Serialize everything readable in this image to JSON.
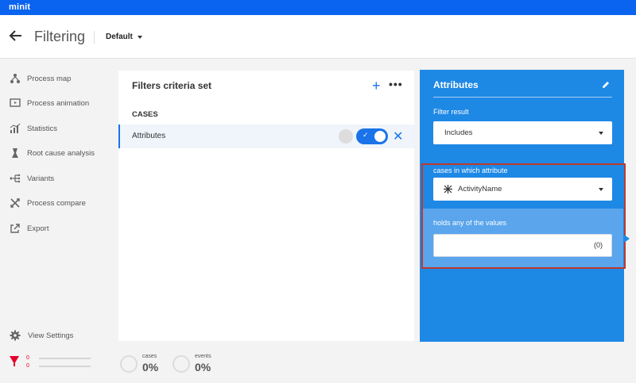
{
  "app": {
    "brand": "minit"
  },
  "header": {
    "title": "Filtering",
    "preset": "Default"
  },
  "sidebar": {
    "items": [
      {
        "label": "Process map",
        "icon": "process-map-icon"
      },
      {
        "label": "Process animation",
        "icon": "process-animation-icon"
      },
      {
        "label": "Statistics",
        "icon": "statistics-icon"
      },
      {
        "label": "Root cause analysis",
        "icon": "root-cause-icon"
      },
      {
        "label": "Variants",
        "icon": "variants-icon"
      },
      {
        "label": "Process compare",
        "icon": "process-compare-icon"
      },
      {
        "label": "Export",
        "icon": "export-icon"
      }
    ],
    "view_settings": "View Settings",
    "filter_counts": [
      "0",
      "0"
    ]
  },
  "filters": {
    "title": "Filters criteria set",
    "section": "CASES",
    "rows": [
      {
        "label": "Attributes",
        "enabled": true
      }
    ]
  },
  "attributes": {
    "title": "Attributes",
    "filter_result_label": "Filter result",
    "filter_result_value": "Includes",
    "attribute_label": "cases in which attribute",
    "attribute_value": "ActivityName",
    "values_label": "holds any of the values",
    "values_count": "(0)"
  },
  "stats": {
    "cases_label": "cases",
    "cases_value": "0%",
    "events_label": "events",
    "events_value": "0%"
  },
  "colors": {
    "brand": "#0a64f0",
    "accent": "#1a73e8",
    "panel": "#1e88e5",
    "highlight": "#c0392b",
    "funnel": "#e4002b"
  }
}
